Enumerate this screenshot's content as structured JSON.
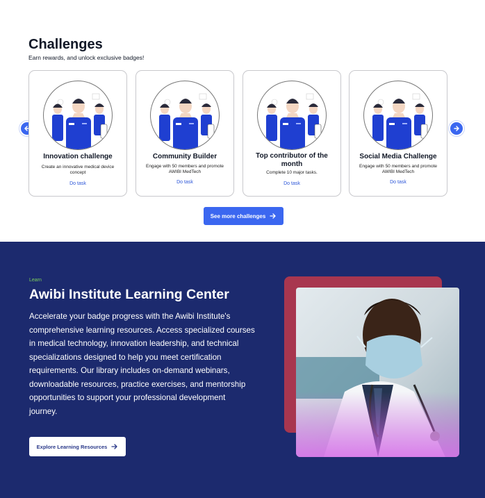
{
  "challenges": {
    "title": "Challenges",
    "subtitle": "Earn rewards, and unlock exclusive badges!",
    "prev_icon": "arrow-left-icon",
    "next_icon": "arrow-right-icon",
    "cards": [
      {
        "title": "Innovation challenge",
        "description": "Create an innovative medical device concept",
        "link": "Do task"
      },
      {
        "title": "Community Builder",
        "description": "Engage with 50 members and promote AWIBI MedTech",
        "link": "Do task"
      },
      {
        "title": "Top contributor of the month",
        "description": "Complete 10 major tasks.",
        "link": "Do task"
      },
      {
        "title": "Social Media Challenge",
        "description": "Engage with 50 members and promote AWIBI MedTech",
        "link": "Do task"
      }
    ],
    "see_more_label": "See more challenges"
  },
  "learning": {
    "eyebrow": "Learn",
    "title": "Awibi Institute Learning Center",
    "body": "Accelerate your badge progress with the Awibi Institute's comprehensive learning resources. Access specialized courses in medical technology, innovation leadership, and technical specializations designed to help you meet certification requirements. Our library includes on-demand webinars, downloadable resources, practice exercises, and mentorship opportunities to support your professional development journey.",
    "button_label": "Explore Learning Resources"
  },
  "colors": {
    "accent_blue": "#3b67f0",
    "section_navy": "#1c2a6e",
    "eyebrow_green": "#7fd35a",
    "photo_frame": "#a8364f"
  }
}
